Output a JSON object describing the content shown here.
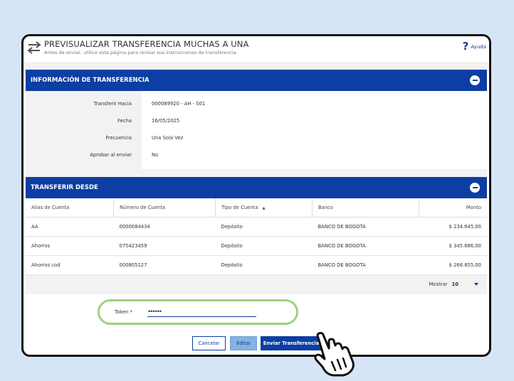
{
  "header": {
    "title": "PREVISUALIZAR TRANSFERENCIA MUCHAS A UNA",
    "subtitle": "Antes de enviar, utilice esta página para revisar sus instrucciones de transferencia.",
    "help_label": "Ayuda",
    "icon": "transfer-arrows-icon"
  },
  "transfer_info": {
    "title": "INFORMACIÓN DE TRANSFERENCIA",
    "rows": [
      {
        "label": "Transferir Hacia",
        "value": "000089920 - AH - S01"
      },
      {
        "label": "Fecha",
        "value": "16/05/2025"
      },
      {
        "label": "Frecuencia",
        "value": "Una Sola Vez"
      },
      {
        "label": "Aprobar al enviar",
        "value": "No"
      }
    ]
  },
  "transfer_from": {
    "title": "TRANSFERIR DESDE",
    "columns": [
      "Alias de Cuenta",
      "Número de Cuenta",
      "Tipo de Cuenta",
      "Banco",
      "Monto"
    ],
    "sort_indicator": "▲",
    "rows": [
      {
        "alias": "AA",
        "number": "0000084434",
        "type": "Depósito",
        "bank": "BANCO DE BOGOTA",
        "amount": "$ 234.645,00"
      },
      {
        "alias": "Ahorros",
        "number": "075423459",
        "type": "Depósito",
        "bank": "BANCO DE BOGOTA",
        "amount": "$ 345.686,00"
      },
      {
        "alias": "Ahorros cod",
        "number": "000805127",
        "type": "Depósito",
        "bank": "BANCO DE BOGOTA",
        "amount": "$ 266.855,00"
      }
    ],
    "show_label": "Mostrar",
    "show_value": "10"
  },
  "token": {
    "label": "Token",
    "required_mark": "*",
    "value": "••••••"
  },
  "buttons": {
    "cancel": "Cancelar",
    "edit": "Editar",
    "send": "Enviar Transferencia"
  },
  "colors": {
    "primary": "#0c3ea3",
    "highlight": "#9bd37c",
    "background": "#d6e5f6"
  }
}
